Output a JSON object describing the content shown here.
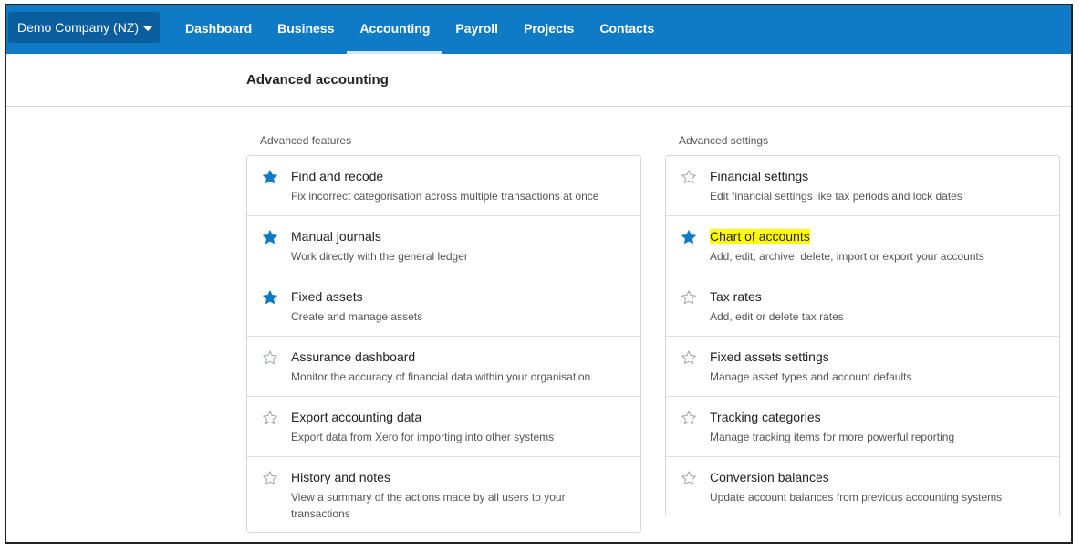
{
  "topbar": {
    "org_name": "Demo Company (NZ)",
    "tabs": [
      {
        "label": "Dashboard"
      },
      {
        "label": "Business"
      },
      {
        "label": "Accounting"
      },
      {
        "label": "Payroll"
      },
      {
        "label": "Projects"
      },
      {
        "label": "Contacts"
      }
    ],
    "active_tab": "Accounting"
  },
  "page": {
    "title": "Advanced accounting"
  },
  "features": {
    "label": "Advanced features",
    "items": [
      {
        "title": "Find and recode",
        "desc": "Fix incorrect categorisation across multiple transactions at once",
        "starred": true
      },
      {
        "title": "Manual journals",
        "desc": "Work directly with the general ledger",
        "starred": true
      },
      {
        "title": "Fixed assets",
        "desc": "Create and manage assets",
        "starred": true
      },
      {
        "title": "Assurance dashboard",
        "desc": "Monitor the accuracy of financial data within your organisation",
        "starred": false
      },
      {
        "title": "Export accounting data",
        "desc": "Export data from Xero for importing into other systems",
        "starred": false
      },
      {
        "title": "History and notes",
        "desc": "View a summary of the actions made by all users to your transactions",
        "starred": false
      }
    ]
  },
  "settings": {
    "label": "Advanced settings",
    "items": [
      {
        "title": "Financial settings",
        "desc": "Edit financial settings like tax periods and lock dates",
        "starred": false
      },
      {
        "title": "Chart of accounts",
        "desc": "Add, edit, archive, delete, import or export your accounts",
        "starred": true
      },
      {
        "title": "Tax rates",
        "desc": "Add, edit or delete tax rates",
        "starred": false
      },
      {
        "title": "Fixed assets settings",
        "desc": "Manage asset types and account defaults",
        "starred": false
      },
      {
        "title": "Tracking categories",
        "desc": "Manage tracking items for more powerful reporting",
        "starred": false
      },
      {
        "title": "Conversion balances",
        "desc": "Update account balances from previous accounting systems",
        "starred": false
      }
    ]
  },
  "colors": {
    "topbar": "#0f7ac6",
    "org_button": "#0b5e9e",
    "star_filled": "#0f7ac6",
    "star_outline": "#9aa0a6",
    "highlight": "#ffff00"
  }
}
